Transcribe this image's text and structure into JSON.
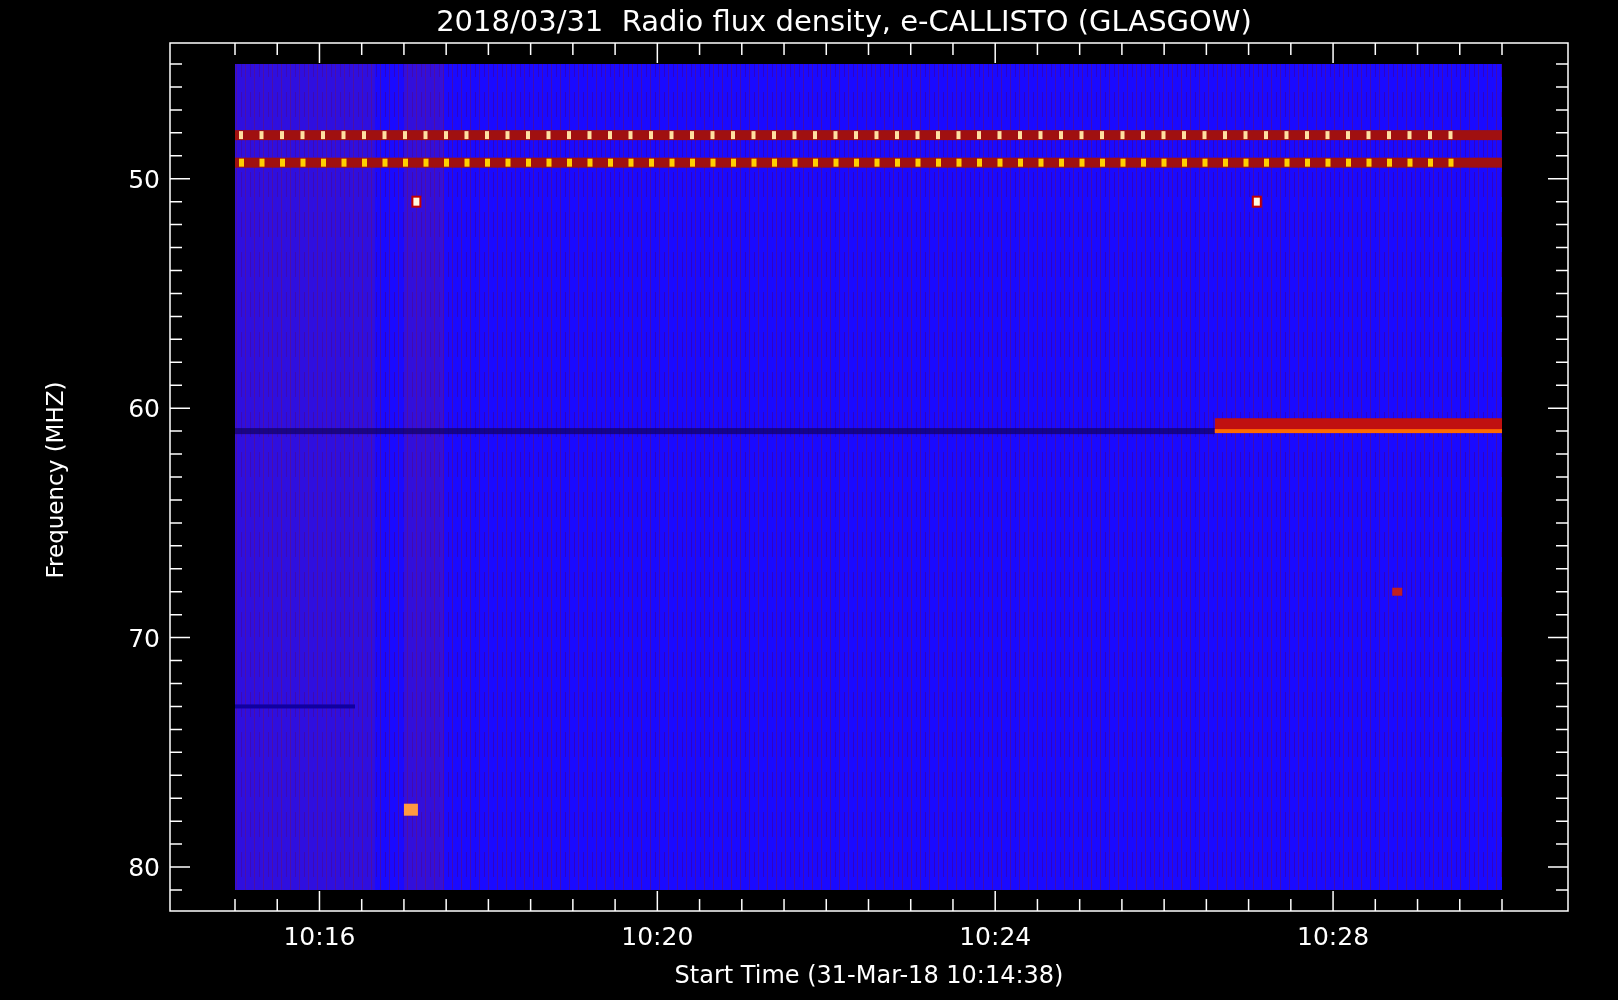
{
  "title": "2018/03/31  Radio flux density, e-CALLISTO (GLASGOW)",
  "y_axis": {
    "label": "Frequency (MHZ)",
    "ticks": [
      "50",
      "60",
      "70",
      "80"
    ]
  },
  "x_axis": {
    "label": "Start Time (31-Mar-18 10:14:38)",
    "ticks": [
      "10:16",
      "10:20",
      "10:24",
      "10:28"
    ]
  }
}
